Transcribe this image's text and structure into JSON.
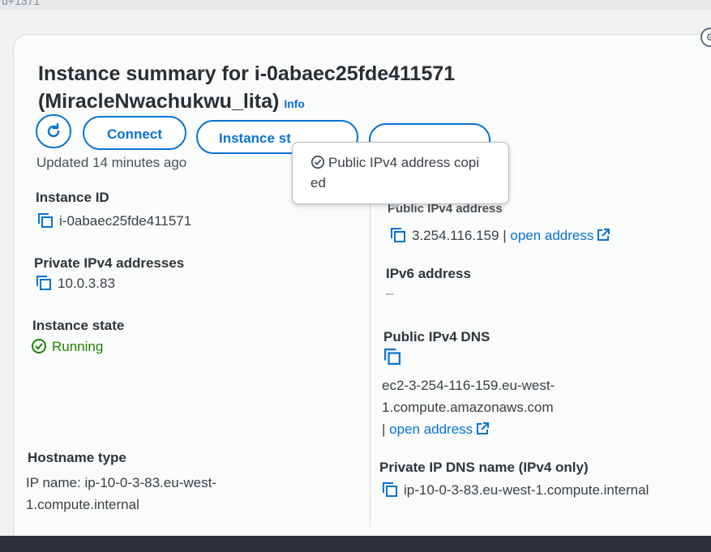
{
  "page": {
    "top_fragment": "u+1371"
  },
  "summary": {
    "title_line1": "Instance summary for i-0abaec25fde411571",
    "title_line2": "(MiracleNwachukwu_lita)",
    "info_link": "Info",
    "updated_text": "Updated 14 minutes ago"
  },
  "buttons": {
    "refresh_icon": "refresh-icon",
    "connect_label": "Connect",
    "instance_state_label": "Instance st",
    "actions_label": ""
  },
  "tooltip": {
    "text": "Public IPv4 address copied",
    "line1": "Public IPv4 address copi",
    "line2": "ed"
  },
  "fields": {
    "instance_id": {
      "label": "Instance ID",
      "value": "i-0abaec25fde411571"
    },
    "private_ipv4": {
      "label": "Private IPv4 addresses",
      "value": "10.0.3.83"
    },
    "instance_state": {
      "label": "Instance state",
      "value": "Running"
    },
    "hostname_type": {
      "label": "Hostname type",
      "line1": "IP name: ip-10-0-3-83.eu-west-",
      "line2": "1.compute.internal"
    },
    "public_ipv4": {
      "label": "Public IPv4 address",
      "value": "3.254.116.159",
      "separator": "|",
      "open_link": "open address"
    },
    "ipv6": {
      "label": "IPv6 address",
      "value": "–"
    },
    "public_dns": {
      "label": "Public IPv4 DNS",
      "line1": "ec2-3-254-116-159.eu-west-",
      "line2": "1.compute.amazonaws.com",
      "separator": "|",
      "open_link": "open address"
    },
    "private_dns": {
      "label": "Private IP DNS name (IPv4 only)",
      "value": "ip-10-0-3-83.eu-west-1.compute.internal"
    }
  },
  "colors": {
    "accent": "#0972d3",
    "running": "#1d8102"
  }
}
